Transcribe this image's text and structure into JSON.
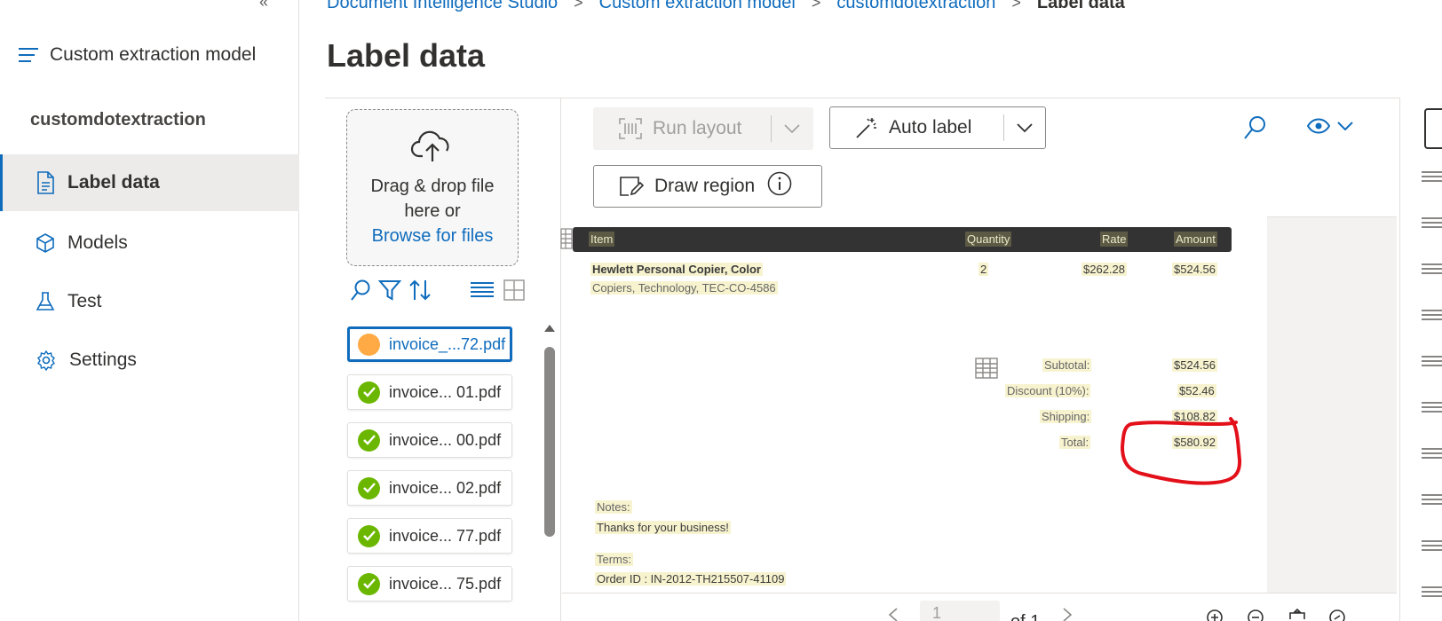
{
  "breadcrumb": {
    "items": [
      "Document Intelligence Studio",
      "Custom extraction model",
      "customdotextraction"
    ],
    "current": "Label data",
    "separator": ">"
  },
  "page_title": "Label data",
  "nav": {
    "collapse_glyph": "«",
    "title": "Custom extraction model",
    "project": "customdotextraction",
    "items": [
      {
        "label": "Label data",
        "icon": "document-icon",
        "active": true
      },
      {
        "label": "Models",
        "icon": "cube-icon",
        "active": false
      },
      {
        "label": "Test",
        "icon": "flask-icon",
        "active": false
      },
      {
        "label": "Settings",
        "icon": "gear-icon",
        "active": false
      }
    ]
  },
  "dropzone": {
    "line1": "Drag & drop file",
    "line2": "here or",
    "browse": "Browse for files"
  },
  "files": [
    {
      "name": "invoice_...72.pdf",
      "status": "pending",
      "selected": true
    },
    {
      "name": "invoice... 01.pdf",
      "status": "ok",
      "selected": false
    },
    {
      "name": "invoice... 00.pdf",
      "status": "ok",
      "selected": false
    },
    {
      "name": "invoice... 02.pdf",
      "status": "ok",
      "selected": false
    },
    {
      "name": "invoice... 77.pdf",
      "status": "ok",
      "selected": false
    },
    {
      "name": "invoice... 75.pdf",
      "status": "ok",
      "selected": false
    }
  ],
  "toolbar": {
    "run_layout": "Run layout",
    "auto_label": "Auto label",
    "draw_region": "Draw region"
  },
  "document": {
    "headers": [
      "Item",
      "Quantity",
      "Rate",
      "Amount"
    ],
    "item_name": "Hewlett Personal Copier, Color",
    "item_detail": "Copiers, Technology, TEC-CO-4586",
    "quantity": "2",
    "rate": "$262.28",
    "amount": "$524.56",
    "subtotal_label": "Subtotal:",
    "subtotal": "$524.56",
    "discount_label": "Discount (10%):",
    "discount": "$52.46",
    "shipping_label": "Shipping:",
    "shipping": "$108.82",
    "total_label": "Total:",
    "total": "$580.92",
    "notes_label": "Notes:",
    "notes": "Thanks for your business!",
    "terms_label": "Terms:",
    "order_id": "Order ID : IN-2012-TH215507-41109"
  },
  "pager": {
    "page": "1",
    "of": "of 1"
  },
  "colors": {
    "accent": "#0f6cbd",
    "success": "#6bb700",
    "pending": "#ffaa44",
    "annotation": "#e3101a",
    "highlight": "#f7f3cf"
  }
}
